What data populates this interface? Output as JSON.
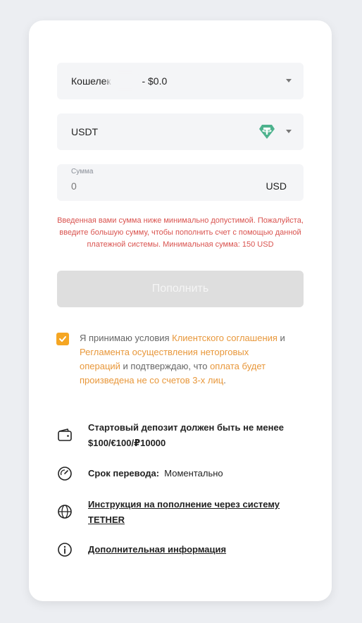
{
  "wallet": {
    "label": "Кошелек",
    "balance": "- $0.0"
  },
  "currency": {
    "value": "USDT",
    "icon": "tether-icon"
  },
  "amount": {
    "label": "Сумма",
    "value": "0",
    "currency": "USD"
  },
  "error_message": "Введенная вами сумма ниже минимально допустимой. Пожалуйста, введите большую сумму, чтобы пополнить счет с помощью данной платежной системы. Минимальная сумма: 150 USD",
  "submit_label": "Пополнить",
  "agreement": {
    "checked": true,
    "text1": "Я принимаю условия ",
    "link1": "Клиентского соглашения",
    "text2": " и ",
    "link2": "Регламента осуществления неторговых операций",
    "text3": " и подтверждаю, что ",
    "link3": "оплата будет произведена не со счетов 3-х лиц",
    "text4": "."
  },
  "info": {
    "deposit_line1": "Стартовый депозит должен быть не менее",
    "deposit_line2": "$100/€100/₽10000",
    "transfer_label": "Срок перевода:",
    "transfer_value": "Моментально",
    "instruction_line1": "Инструкция на пополнение через систему",
    "instruction_line2": "TETHER",
    "more_info": "Дополнительная информация"
  },
  "colors": {
    "accent": "#e8973a",
    "error": "#d9534f",
    "tether": "#4db28d"
  }
}
